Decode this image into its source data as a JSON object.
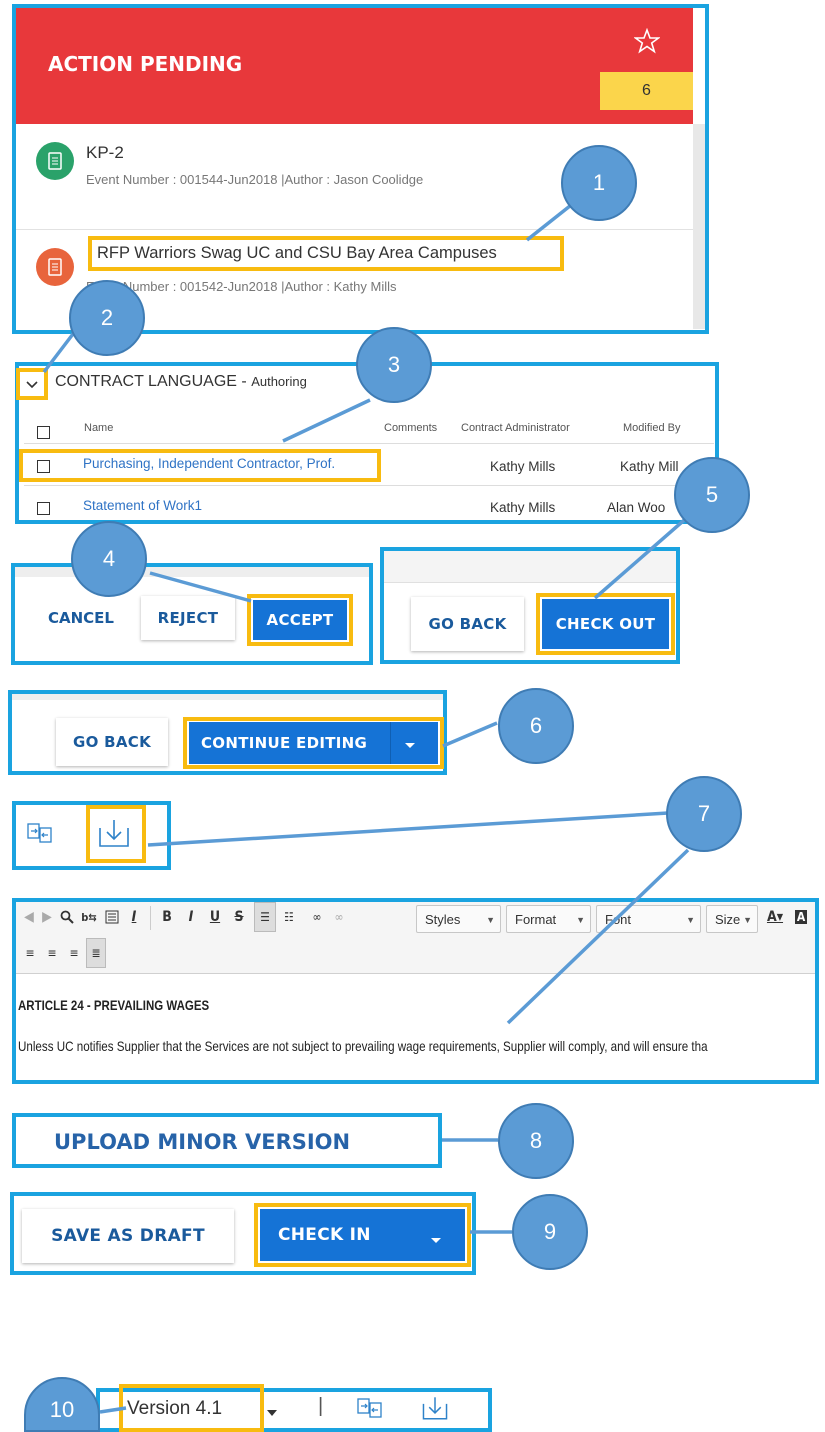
{
  "action_pending": {
    "title": "ACTION PENDING",
    "count": "6",
    "items": [
      {
        "title": "KP-2",
        "meta": "Event Number : 001544-Jun2018 |Author : Jason Coolidge",
        "color": "#2aa26a"
      },
      {
        "title": "RFP Warriors Swag UC and CSU Bay Area Campuses",
        "meta": "Event Number : 001542-Jun2018 |Author : Kathy Mills",
        "color": "#e8643c"
      }
    ]
  },
  "contract_language": {
    "title": "CONTRACT LANGUAGE",
    "subtitle": "Authoring",
    "columns": [
      "Name",
      "Comments",
      "Contract Administrator",
      "Modified By"
    ],
    "rows": [
      {
        "name": "Purchasing, Independent Contractor, Prof.",
        "admin": "Kathy Mills",
        "modified": "Kathy Mill"
      },
      {
        "name": "Statement of Work1",
        "admin": "Kathy Mills",
        "modified": "Alan Woo"
      }
    ]
  },
  "buttons": {
    "cancel": "CANCEL",
    "reject": "REJECT",
    "accept": "ACCEPT",
    "go_back": "GO BACK",
    "check_out": "CHECK OUT",
    "continue_editing": "CONTINUE EDITING",
    "upload_minor": "UPLOAD MINOR VERSION",
    "save_as_draft": "SAVE AS DRAFT",
    "check_in": "CHECK IN"
  },
  "editor": {
    "combos": [
      "Styles",
      "Format",
      "Font",
      "Size"
    ],
    "article_title": "ARTICLE 24 - PREVAILING WAGES",
    "article_text": "Unless UC notifies Supplier that the Services are not subject to prevailing wage requirements, Supplier will comply, and will ensure tha"
  },
  "version": {
    "label": "Version 4.1",
    "separator": "|"
  },
  "callouts": [
    "1",
    "2",
    "3",
    "4",
    "5",
    "6",
    "7",
    "8",
    "9",
    "10"
  ],
  "colors": {
    "frame": "#1aa3e0",
    "highlight": "#f8bb10",
    "callout": "#5b9bd5",
    "header_red": "#e8383b",
    "primary": "#1573d6"
  }
}
